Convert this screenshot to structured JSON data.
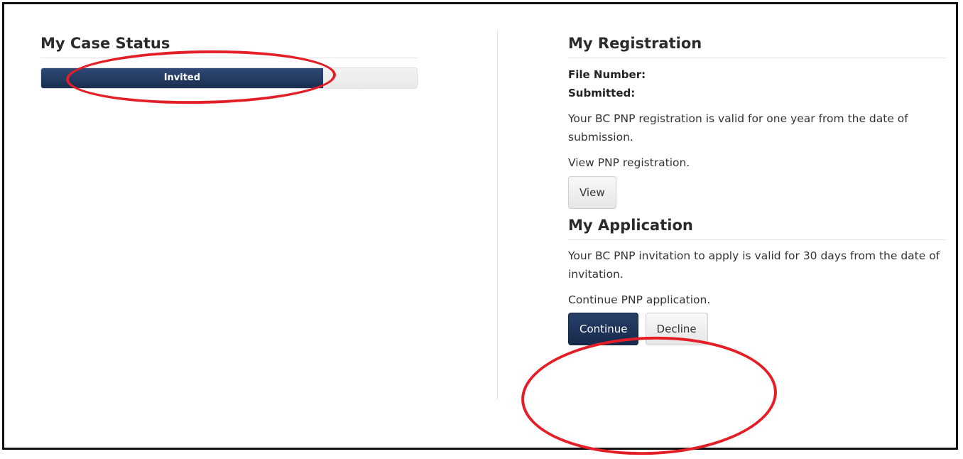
{
  "case_status": {
    "title": "My Case Status",
    "progress_label": "Invited",
    "progress_fraction": 0.75,
    "fill_color": "#1e3157"
  },
  "registration": {
    "title": "My Registration",
    "file_number_label": "File Number:",
    "submitted_label": "Submitted:",
    "validity_text": "Your BC PNP registration is valid for one year from the date of submission.",
    "view_prompt": "View PNP registration.",
    "view_button": "View"
  },
  "application": {
    "title": "My Application",
    "validity_text": "Your BC PNP invitation to apply is valid for 30 days from the date of invitation.",
    "continue_prompt": "Continue PNP application.",
    "continue_button": "Continue",
    "decline_button": "Decline"
  },
  "colors": {
    "primary": "#1e3157",
    "annotation": "#e41e26"
  }
}
